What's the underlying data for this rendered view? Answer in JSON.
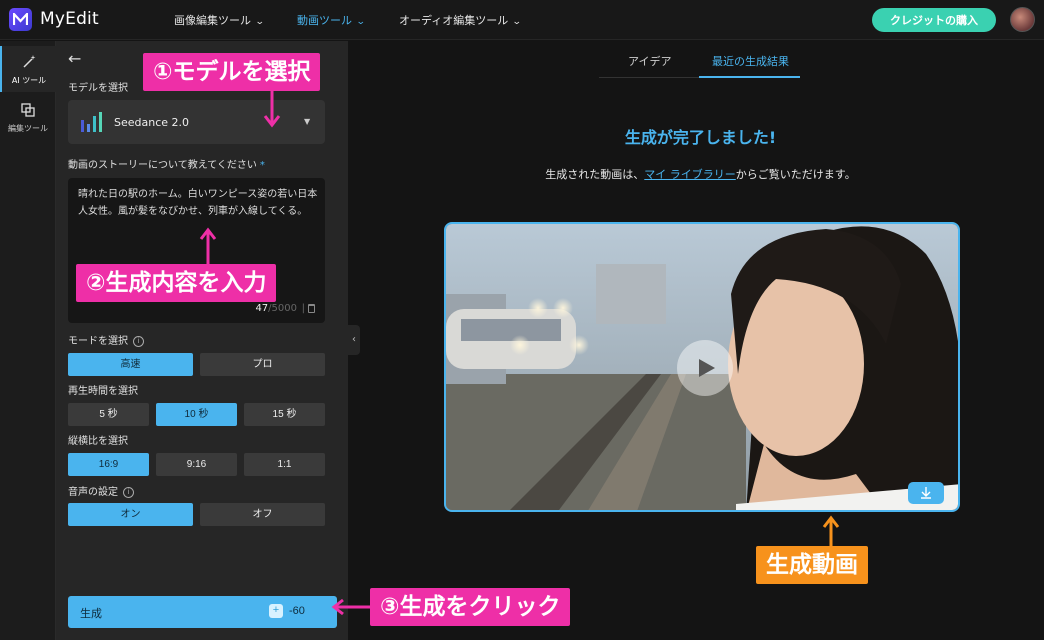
{
  "app": {
    "name": "MyEdit"
  },
  "nav": [
    {
      "label": "画像編集ツール",
      "active": false
    },
    {
      "label": "動画ツール",
      "active": true
    },
    {
      "label": "オーディオ編集ツール",
      "active": false
    }
  ],
  "header": {
    "buy_label": "クレジットの購入"
  },
  "rail": [
    {
      "label": "AI ツール",
      "icon": "magic-wand-icon",
      "active": true
    },
    {
      "label": "編集ツール",
      "icon": "crop-icon",
      "active": false
    }
  ],
  "panel": {
    "model_label": "モデルを選択",
    "model_value": "Seedance 2.0",
    "story_label": "動画のストーリーについて教えてください",
    "story_required": "*",
    "story_text": "晴れた日の駅のホーム。白いワンピース姿の若い日本人女性。風が髪をなびかせ、列車が入線してくる。",
    "char_count": "47",
    "char_max": "/5000",
    "mode_label": "モードを選択",
    "mode_options": [
      {
        "label": "高速",
        "selected": true
      },
      {
        "label": "プロ",
        "selected": false
      }
    ],
    "duration_label": "再生時間を選択",
    "duration_options": [
      {
        "label": "5 秒",
        "selected": false
      },
      {
        "label": "10 秒",
        "selected": true
      },
      {
        "label": "15 秒",
        "selected": false
      }
    ],
    "ratio_label": "縦横比を選択",
    "ratio_options": [
      {
        "label": "16:9",
        "selected": true
      },
      {
        "label": "9:16",
        "selected": false
      },
      {
        "label": "1:1",
        "selected": false
      }
    ],
    "audio_label": "音声の設定",
    "audio_options": [
      {
        "label": "オン",
        "selected": true
      },
      {
        "label": "オフ",
        "selected": false
      }
    ],
    "generate_label": "生成",
    "generate_cost": "-60"
  },
  "tabs": [
    {
      "label": "アイデア",
      "active": false
    },
    {
      "label": "最近の生成結果",
      "active": true
    }
  ],
  "result": {
    "title": "生成が完了しました!",
    "sub_before": "生成された動画は、",
    "sub_link": "マイ ライブラリー",
    "sub_after": "からご覧いただけます。"
  },
  "callouts": {
    "step1": "①モデルを選択",
    "step2": "②生成内容を入力",
    "step3": "③生成をクリック",
    "video": "生成動画"
  },
  "colors": {
    "accent": "#4ab4ee",
    "callout_pink": "#ee2fa7",
    "callout_orange": "#f7921c",
    "buy_button": "#3ad1b1"
  }
}
